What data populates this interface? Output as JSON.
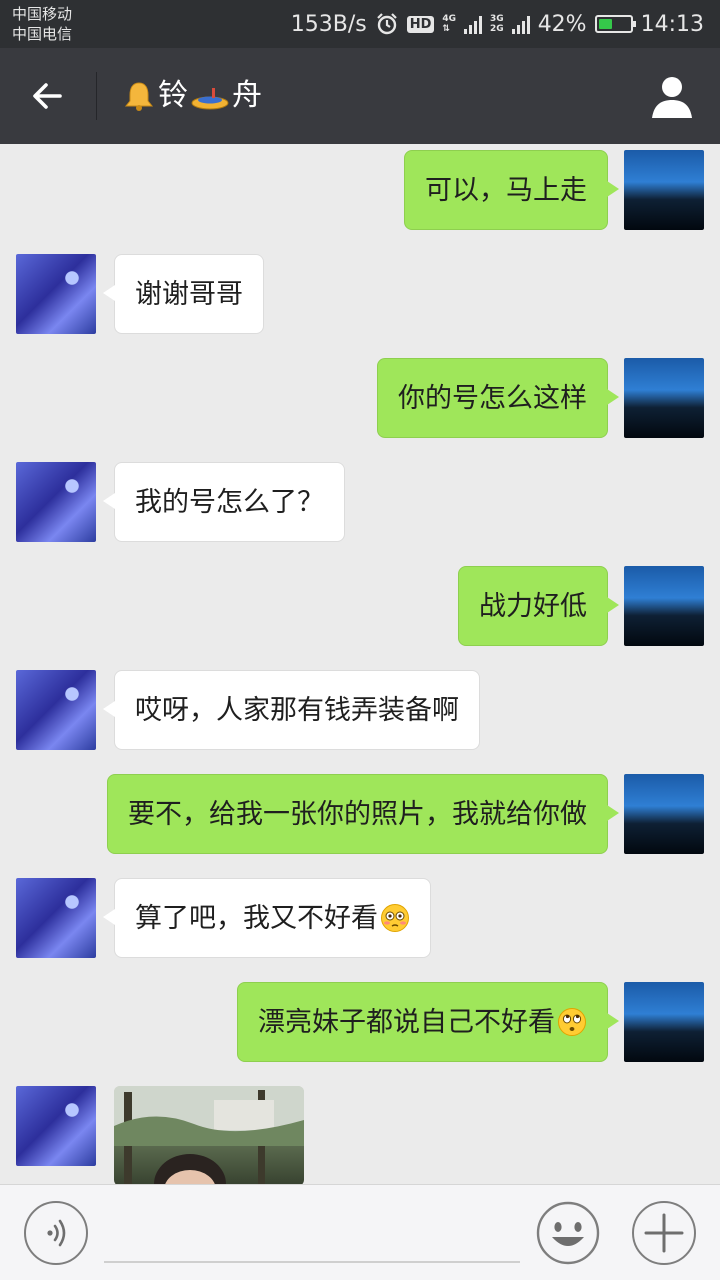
{
  "status_bar": {
    "carrier_1": "中国移动",
    "carrier_2": "中国电信",
    "net_speed": "153B/s",
    "hd": "HD",
    "net_1": "4G",
    "net_2a": "3G",
    "net_2b": "2G",
    "battery_level": 42,
    "battery": "42%",
    "time": "14:13"
  },
  "header": {
    "title_name_1": "铃",
    "title_name_2": "舟",
    "title_emoji_1": "bell-icon",
    "title_emoji_2": "boat-icon"
  },
  "messages": [
    {
      "side": "right",
      "text": "可以，马上走"
    },
    {
      "side": "left",
      "text": "谢谢哥哥"
    },
    {
      "side": "right",
      "text": "你的号怎么这样"
    },
    {
      "side": "left",
      "text": "我的号怎么了？"
    },
    {
      "side": "right",
      "text": "战力好低"
    },
    {
      "side": "left",
      "text": "哎呀，人家那有钱弄装备啊"
    },
    {
      "side": "right",
      "text": "要不，给我一张你的照片，我就给你做"
    },
    {
      "side": "left",
      "text": "算了吧，我又不好看",
      "emoji": "flushed-face-icon"
    },
    {
      "side": "right",
      "text": "漂亮妹子都说自己不好看",
      "emoji": "eye-roll-face-icon"
    },
    {
      "side": "left",
      "type": "photo"
    }
  ],
  "input": {
    "value": "",
    "placeholder": ""
  },
  "colors": {
    "status_bg": "#2e3033",
    "header_bg": "#393a3f",
    "chat_bg": "#ebebeb",
    "outgoing_bubble": "#9fe65a",
    "incoming_bubble": "#ffffff",
    "battery_fill": "#35c84a"
  }
}
